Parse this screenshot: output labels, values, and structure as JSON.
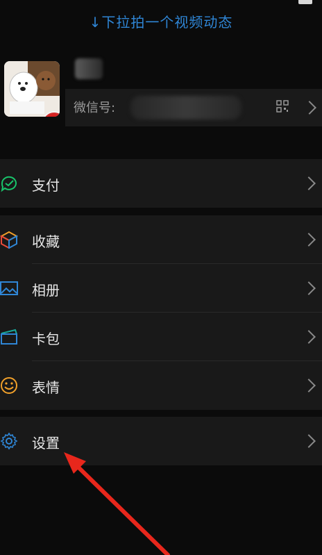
{
  "header": {
    "pull_hint": "↓下拉拍一个视频动态"
  },
  "profile": {
    "wechat_id_label": "微信号:"
  },
  "menu": {
    "pay": "支付",
    "favorites": "收藏",
    "album": "相册",
    "cards": "卡包",
    "stickers": "表情",
    "settings": "设置"
  },
  "colors": {
    "background": "#0b0b0b",
    "row": "#191919",
    "accent_blue": "#2f86d6",
    "pay_green": "#19c46b",
    "annotation_red": "#e8271c"
  }
}
